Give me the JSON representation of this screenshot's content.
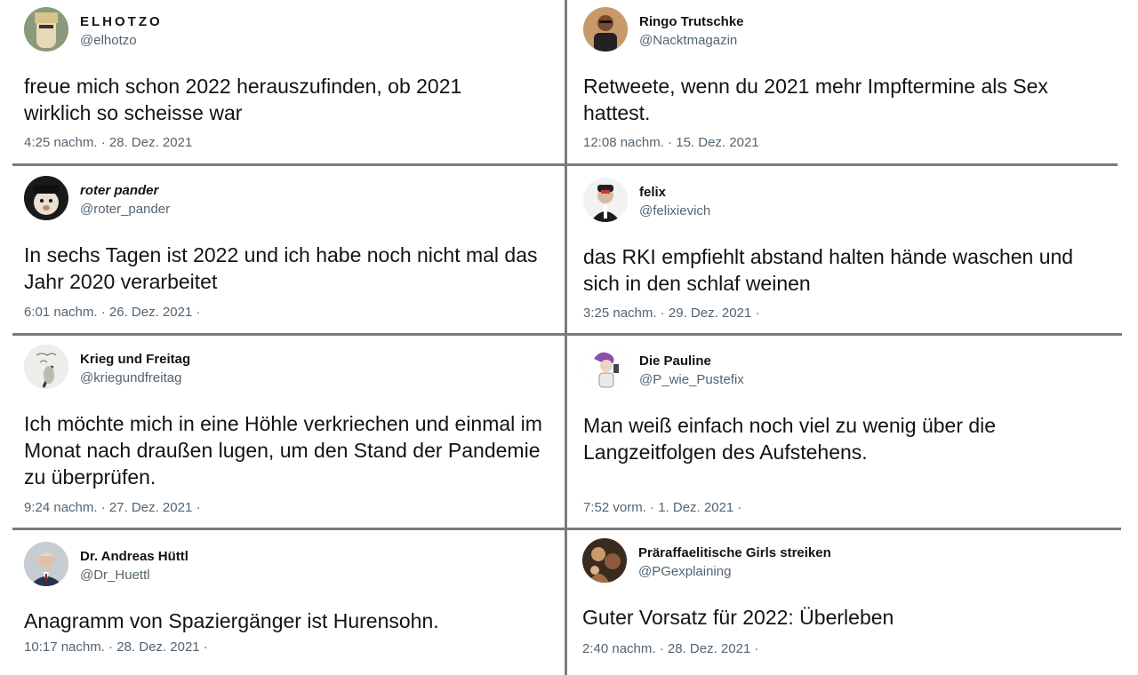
{
  "tweets": [
    {
      "display_name": "ELHOTZO",
      "handle": "@elhotzo",
      "text": "freue mich schon 2022 herauszufinden, ob 2021 wirklich so scheisse war",
      "timestamp": "4:25 nachm. · 28. Dez. 2021"
    },
    {
      "display_name": "Ringo Trutschke",
      "handle": "@Nacktmagazin",
      "text": "Retweete, wenn du 2021 mehr Impftermine als Sex hattest.",
      "timestamp": "12:08 nachm. · 15. Dez. 2021"
    },
    {
      "display_name": "roter pander",
      "handle": "@roter_pander",
      "text": "In sechs Tagen ist 2022 und ich habe noch nicht mal das Jahr 2020 verarbeitet",
      "timestamp": "6:01 nachm. · 26. Dez. 2021 ·"
    },
    {
      "display_name": "felix",
      "handle": "@felixievich",
      "text": "das RKI empfiehlt abstand halten hände waschen und sich in den schlaf weinen",
      "timestamp": "3:25 nachm. · 29. Dez. 2021 ·"
    },
    {
      "display_name": "Krieg und Freitag",
      "handle": "@kriegundfreitag",
      "text": "Ich möchte mich in eine Höhle verkriechen und einmal im Monat nach draußen lugen, um den Stand der Pandemie zu überprüfen.",
      "timestamp": "9:24 nachm. · 27. Dez. 2021 ·"
    },
    {
      "display_name": "Die Pauline",
      "handle": "@P_wie_Pustefix",
      "text": "Man weiß einfach noch viel zu wenig über die Langzeitfolgen des Aufstehens.",
      "timestamp": "7:52 vorm. · 1. Dez. 2021 ·"
    },
    {
      "display_name": "Dr. Andreas Hüttl",
      "handle": "@Dr_Huettl",
      "text": "Anagramm von Spaziergänger ist Hurensohn.",
      "timestamp": "10:17 nachm. · 28. Dez. 2021 ·"
    },
    {
      "display_name": "Präraffaelitische Girls streiken",
      "handle": "@PGexplaining",
      "text": "Guter Vorsatz für 2022: Überleben",
      "timestamp": "2:40 nachm. · 28. Dez. 2021 ·"
    }
  ]
}
